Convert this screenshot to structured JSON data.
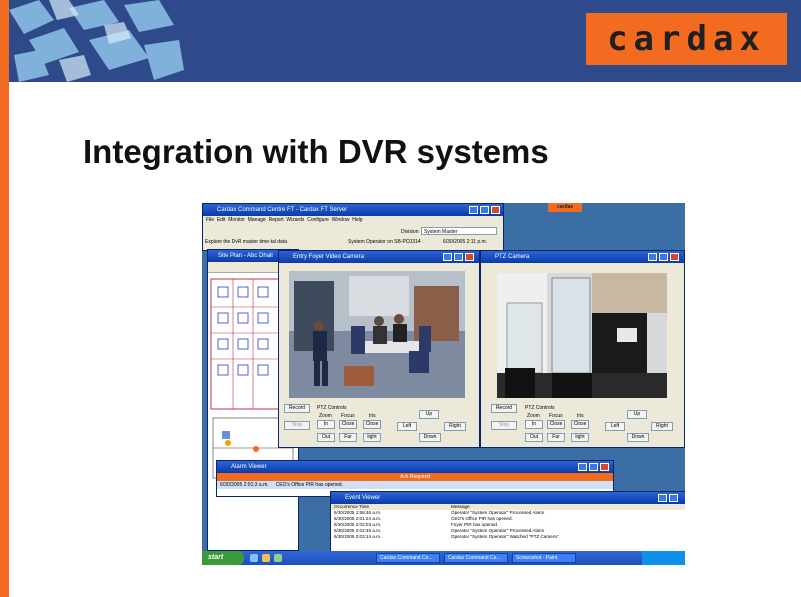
{
  "slide": {
    "logo": "cardax",
    "title": "Integration with DVR systems"
  },
  "command_centre": {
    "title": "Cardax Command Centre FT - Cardax FT Server",
    "menu": [
      "File",
      "Edit",
      "Monitor",
      "Manage",
      "Report",
      "Wizards",
      "Configure",
      "Window",
      "Help"
    ],
    "division_label": "Division",
    "division_value": "System Master",
    "status_left": "Explore the DvR master time-tal data",
    "status_mid": "System Operator on SB-PC0314",
    "status_right": "6/30/2005 2:11 p.m."
  },
  "site_plan": {
    "title": "Site Plan - Abc Dhall"
  },
  "entry_camera": {
    "title": "Entry Foyer Video Camera"
  },
  "ptz_camera": {
    "title": "PTZ Camera"
  },
  "ptz_controls": {
    "group_label": "PTZ Controls",
    "record": "Record",
    "stop": "Stop",
    "zoom": "Zoom",
    "focus": "Focus",
    "iris": "Iris",
    "in": "In",
    "out": "Out",
    "close": "Close",
    "far": "Far",
    "near": "Near",
    "open": "Open",
    "light": "light",
    "up": "Up",
    "left": "Left",
    "right": "Right",
    "down": "Down"
  },
  "alarm_viewer": {
    "title": "Alarm Viewer",
    "header": "Ack Required",
    "row_time": "6/30/2005 2:01:3 a.m.",
    "row_text": "CEO's Office PIR has opened."
  },
  "event_viewer": {
    "title": "Event Viewer",
    "col_time": "Occurrence Time",
    "col_message": "Message",
    "rows": [
      {
        "time": "6/30/2005 1:58:46 a.m.",
        "message": "Operator \"System Operator\" Processed Alarm"
      },
      {
        "time": "6/30/2005 2:01:24 a.m.",
        "message": "CEO's Office PIR has opened."
      },
      {
        "time": "6/30/2005 2:02:03 a.m.",
        "message": "Foyer PIR has opened."
      },
      {
        "time": "6/30/2005 2:02:45 a.m.",
        "message": "Operator \"System Operator\" Processed Alarm"
      },
      {
        "time": "6/30/2005 2:03:14 a.m.",
        "message": "Operator \"System Operator\" Watched \"PTZ Camera\""
      }
    ]
  },
  "taskbar": {
    "start": "start",
    "tasks": [
      "Cardax Command Ce...",
      "Cardax Command Ce...",
      "Screenshot - Paint"
    ]
  }
}
